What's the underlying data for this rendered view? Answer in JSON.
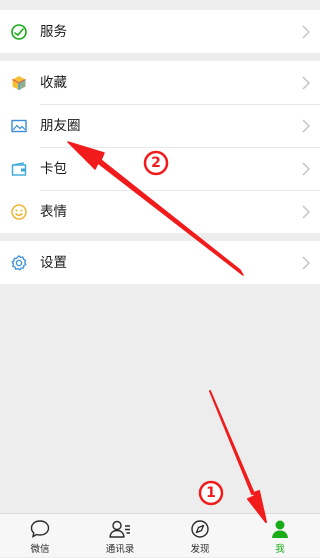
{
  "menu": {
    "services_label": "服务",
    "favorites_label": "收藏",
    "moments_label": "朋友圈",
    "cards_label": "卡包",
    "stickers_label": "表情",
    "settings_label": "设置"
  },
  "tabbar": {
    "chats_label": "微信",
    "contacts_label": "通讯录",
    "discover_label": "发现",
    "me_label": "我"
  },
  "annotations": {
    "step1": "1",
    "step2": "2"
  },
  "colors": {
    "accent": "#1aad19",
    "annotation": "#f21b1b",
    "background": "#ededed"
  },
  "icons": [
    "wechat-pay-icon",
    "cube-icon",
    "picture-icon",
    "wallet-icon",
    "smiley-icon",
    "gear-icon",
    "chat-bubble-icon",
    "contacts-icon",
    "compass-icon",
    "person-icon"
  ]
}
